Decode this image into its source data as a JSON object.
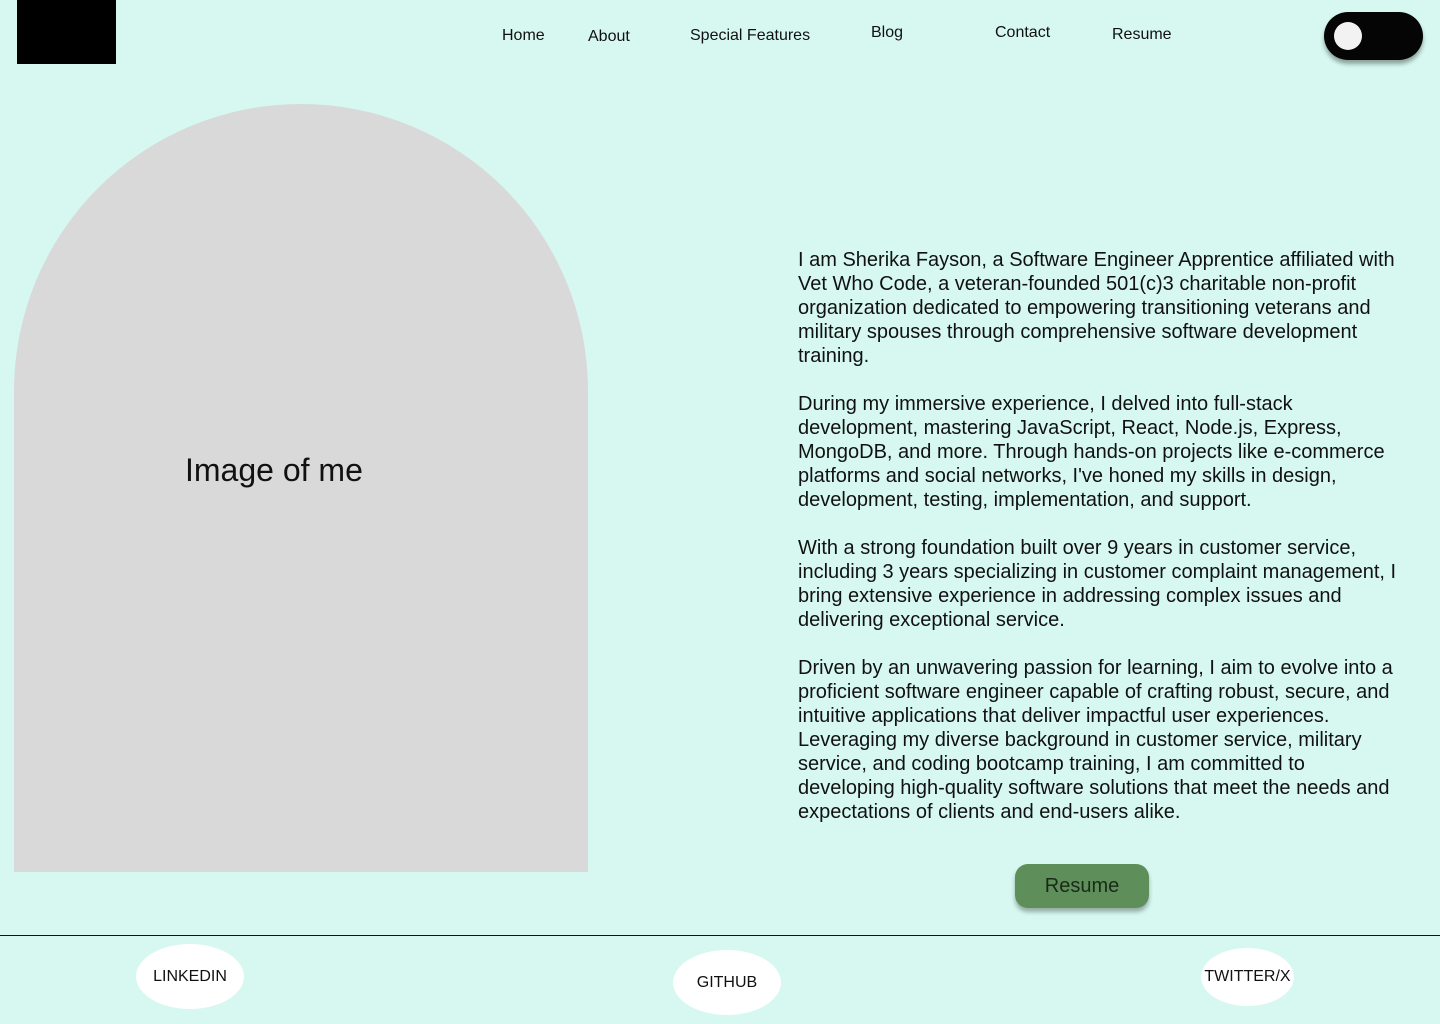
{
  "nav": {
    "links": [
      "Home",
      "About",
      "Special Features",
      "Blog",
      "Contact",
      "Resume"
    ]
  },
  "hero": {
    "image_label": "Image of me"
  },
  "bio": {
    "paragraphs": [
      "I am Sherika Fayson, a Software Engineer Apprentice affiliated with Vet Who Code, a veteran-founded 501(c)3 charitable non-profit organization dedicated to empowering transitioning veterans and military spouses through comprehensive software development training.",
      "During my immersive experience, I delved into full-stack development, mastering JavaScript, React, Node.js, Express, MongoDB, and more. Through hands-on projects like e-commerce platforms and social networks, I've honed my skills in design, development, testing, implementation, and support.",
      "With a strong foundation built over 9 years in customer service, including 3 years specializing in customer complaint management, I bring extensive experience in addressing complex issues and delivering exceptional service.",
      "Driven by an unwavering passion for learning, I aim to evolve into a proficient software engineer capable of crafting robust, secure, and intuitive applications that deliver impactful user experiences. Leveraging my diverse background in customer service, military service, and coding bootcamp training, I am committed to developing high-quality software solutions that meet the needs and expectations of clients and end-users alike."
    ],
    "resume_button": "Resume"
  },
  "footer": {
    "linkedin": "LINKEDIN",
    "github": "GITHUB",
    "twitter": "TWITTER/X"
  },
  "colors": {
    "background": "#d6f8f0",
    "placeholder": "#d9d9d9",
    "button": "#5e8f5a",
    "toggle": "#050505"
  }
}
